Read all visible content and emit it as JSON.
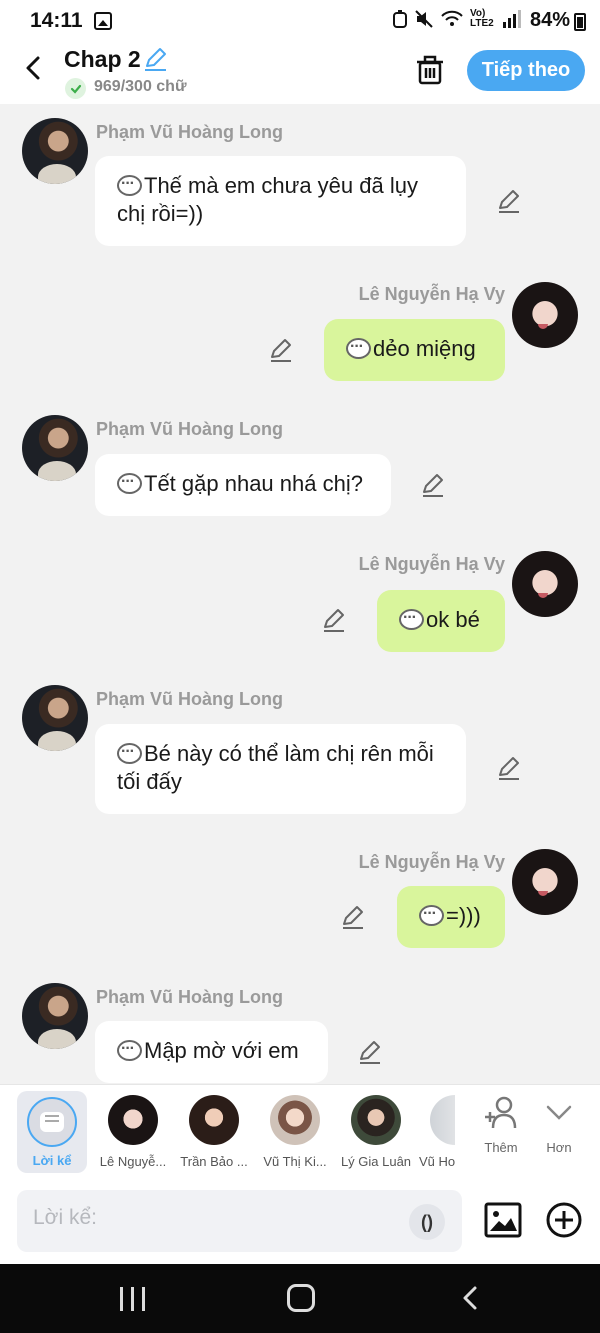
{
  "status_bar": {
    "time": "14:11",
    "network": "Vo) LTE2",
    "battery": "84%"
  },
  "header": {
    "title": "Chap 2",
    "word_count": "969/300 chữ",
    "next_label": "Tiếp theo"
  },
  "messages": [
    {
      "side": "left",
      "sender": "Phạm Vũ Hoàng Long",
      "text": "Thế mà em chưa yêu đã lụy chị rồi=))"
    },
    {
      "side": "right",
      "sender": "Lê Nguyễn Hạ Vy",
      "text": "dẻo miệng"
    },
    {
      "side": "left",
      "sender": "Phạm Vũ Hoàng Long",
      "text": "Tết gặp nhau nhá chị?"
    },
    {
      "side": "right",
      "sender": "Lê Nguyễn Hạ Vy",
      "text": "ok bé"
    },
    {
      "side": "left",
      "sender": "Phạm Vũ Hoàng Long",
      "text": "Bé này có thể làm chị rên mỗi tối đấy"
    },
    {
      "side": "right",
      "sender": "Lê Nguyễn Hạ Vy",
      "text": "=)))"
    },
    {
      "side": "left",
      "sender": "Phạm Vũ Hoàng Long",
      "text": "Mập mờ với em"
    }
  ],
  "characters": {
    "narrator_label": "Lời kể",
    "items": [
      "Lê Nguyễ...",
      "Trần Bảo ...",
      "Vũ Thị Ki...",
      "Lý Gia Luân",
      "Vũ Ho"
    ],
    "add_label": "Thêm",
    "more_label": "Hơn"
  },
  "input": {
    "placeholder": "Lời kể:",
    "paren_label": "()"
  },
  "colors": {
    "accent": "#4aa8f2",
    "right_bubble": "#d9f59c",
    "left_bubble": "#ffffff",
    "background": "#f2f2f2"
  }
}
